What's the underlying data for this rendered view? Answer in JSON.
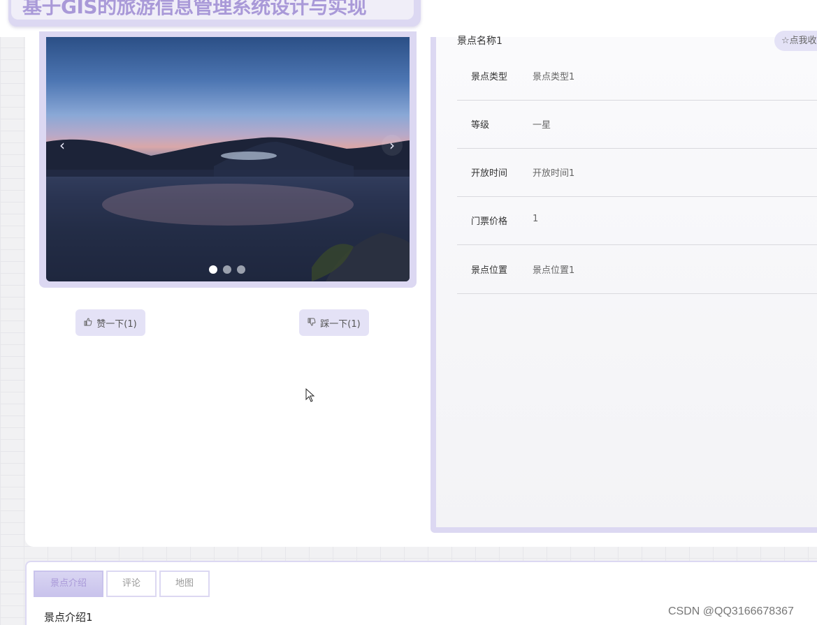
{
  "site": {
    "title": "基于GIS的旅游信息管理系统设计与实现"
  },
  "carousel": {
    "prev_label": "‹",
    "next_label": "›",
    "slide_count": 3,
    "active_index": 0
  },
  "votes": {
    "like_label": "赞一下(1)",
    "dislike_label": "踩一下(1)",
    "like_icon": "thumbs-up-icon",
    "dislike_icon": "thumbs-down-icon"
  },
  "spot": {
    "name": "景点名称1",
    "favorite_label": "☆点我收藏",
    "details": [
      {
        "label": "景点类型",
        "value": "景点类型1"
      },
      {
        "label": "等级",
        "value": "一星"
      },
      {
        "label": "开放时间",
        "value": "开放时间1"
      },
      {
        "label": "门票价格",
        "value": "1"
      },
      {
        "label": "景点位置",
        "value": "景点位置1"
      }
    ]
  },
  "tabs": [
    {
      "label": "景点介绍",
      "active": true
    },
    {
      "label": "评论",
      "active": false
    },
    {
      "label": "地图",
      "active": false
    }
  ],
  "intro": {
    "text": "景点介绍1"
  },
  "watermark": "CSDN @QQ3166678367",
  "colors": {
    "accent": "#a999d8",
    "frame": "#dcd8f2",
    "button_bg": "#e4e2f6"
  }
}
